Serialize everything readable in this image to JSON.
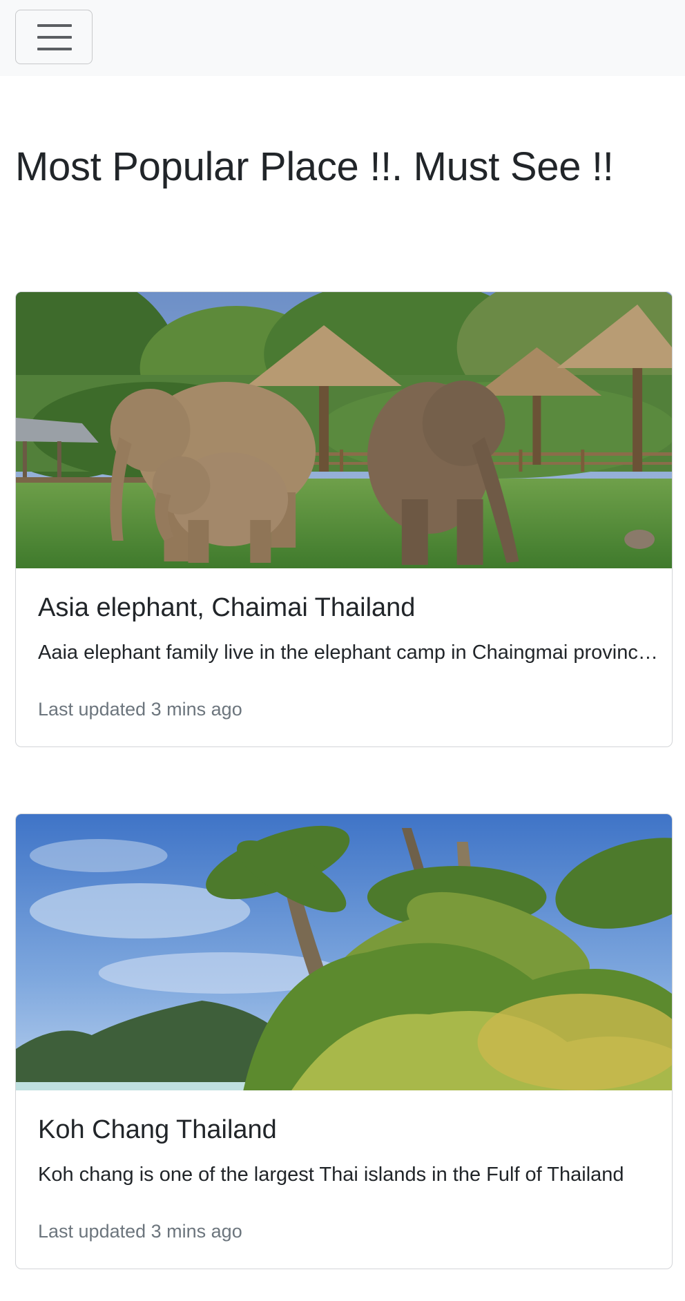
{
  "navbar": {
    "toggler_icon": "hamburger-menu-icon"
  },
  "page": {
    "title": "Most Popular Place !!. Must See !!"
  },
  "cards": [
    {
      "image_icon": "elephant-photo",
      "title": "Asia elephant, Chaimai Thailand",
      "text": "Aaia elephant family live in the elephant camp in Chaingmai province, Thailand",
      "meta": "Last updated 3 mins ago"
    },
    {
      "image_icon": "palm-beach-photo",
      "title": "Koh Chang Thailand",
      "text": "Koh chang is one of the largest Thai islands in the Fulf of Thailand",
      "meta": "Last updated 3 mins ago"
    }
  ],
  "colors": {
    "navbar_bg": "#f8f9fa",
    "text": "#212529",
    "muted": "#6c757d",
    "border": "#d3d5d8"
  }
}
